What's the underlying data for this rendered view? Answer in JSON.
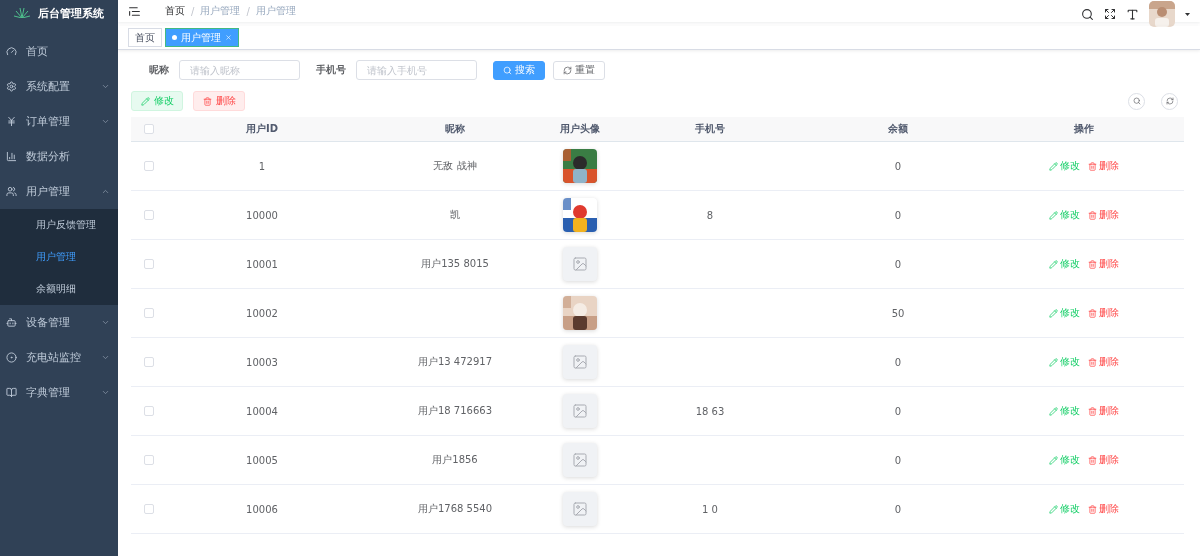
{
  "sidebar": {
    "title": "后台管理系统",
    "items": [
      {
        "label": "首页",
        "kind": "link",
        "selected": false
      },
      {
        "label": "系统配置",
        "kind": "group",
        "expanded": false,
        "selected": false
      },
      {
        "label": "订单管理",
        "kind": "group",
        "expanded": false,
        "selected": false
      },
      {
        "label": "数据分析",
        "kind": "link",
        "selected": false
      },
      {
        "label": "用户管理",
        "kind": "group",
        "expanded": true,
        "selected": false,
        "children": [
          {
            "label": "用户反馈管理",
            "selected": false
          },
          {
            "label": "用户管理",
            "selected": true
          },
          {
            "label": "余额明细",
            "selected": false
          }
        ]
      },
      {
        "label": "设备管理",
        "kind": "group",
        "expanded": false,
        "selected": false
      },
      {
        "label": "充电站监控",
        "kind": "group",
        "expanded": false,
        "selected": false
      },
      {
        "label": "字典管理",
        "kind": "group",
        "expanded": false,
        "selected": false
      }
    ]
  },
  "breadcrumb": [
    {
      "kind": "crumb",
      "text": "首页"
    },
    {
      "kind": "separator",
      "text": "/"
    },
    {
      "kind": "crumb",
      "text": "用户管理"
    },
    {
      "kind": "separator",
      "text": "/"
    },
    {
      "kind": "crumb",
      "text": "用户管理"
    }
  ],
  "tags": [
    {
      "label": "首页",
      "selected": false
    },
    {
      "label": "用户管理",
      "selected": true
    }
  ],
  "search_form": {
    "fields": [
      {
        "label": "昵称",
        "placeholder": "请输入昵称"
      },
      {
        "label": "手机号",
        "placeholder": "请输入手机号"
      }
    ],
    "buttons": [
      {
        "label": "搜索",
        "kind": "primary"
      },
      {
        "label": "重置",
        "kind": "default"
      }
    ]
  },
  "toolbar": [
    {
      "label": "修改",
      "kind": "edit"
    },
    {
      "label": "删除",
      "kind": "delete"
    }
  ],
  "table": {
    "all_selected": false,
    "columns": [
      "用户ID",
      "昵称",
      "用户头像",
      "手机号",
      "余额",
      "操作"
    ],
    "rows": [
      {
        "selected": false,
        "id": "1",
        "nickname": "无敌 战神",
        "avatar": {
          "kind": "picture"
        },
        "balance": "0",
        "actions": [
          "修改",
          "删除"
        ]
      },
      {
        "selected": false,
        "id": "10000",
        "nickname": "凯",
        "avatar": {
          "kind": "picture"
        },
        "phone": "8",
        "balance": "0",
        "actions": [
          "修改",
          "删除"
        ]
      },
      {
        "selected": false,
        "id": "10001",
        "nickname": "用户135 8015",
        "avatar": {
          "kind": "placeholder"
        },
        "balance": "0",
        "actions": [
          "修改",
          "删除"
        ]
      },
      {
        "selected": false,
        "id": "10002",
        "avatar": {
          "kind": "picture"
        },
        "balance": "50",
        "actions": [
          "修改",
          "删除"
        ]
      },
      {
        "selected": false,
        "id": "10003",
        "nickname": "用户13 472917",
        "avatar": {
          "kind": "placeholder"
        },
        "balance": "0",
        "actions": [
          "修改",
          "删除"
        ]
      },
      {
        "selected": false,
        "id": "10004",
        "nickname": "用户18 716663",
        "avatar": {
          "kind": "placeholder"
        },
        "phone": "18 63",
        "balance": "0",
        "actions": [
          "修改",
          "删除"
        ]
      },
      {
        "selected": false,
        "id": "10005",
        "nickname": "用户1856",
        "avatar": {
          "kind": "placeholder"
        },
        "balance": "0",
        "actions": [
          "修改",
          "删除"
        ]
      },
      {
        "selected": false,
        "id": "10006",
        "nickname": "用户1768 5540",
        "avatar": {
          "kind": "placeholder"
        },
        "phone": "1 0",
        "balance": "0",
        "actions": [
          "修改",
          "删除"
        ]
      }
    ]
  }
}
